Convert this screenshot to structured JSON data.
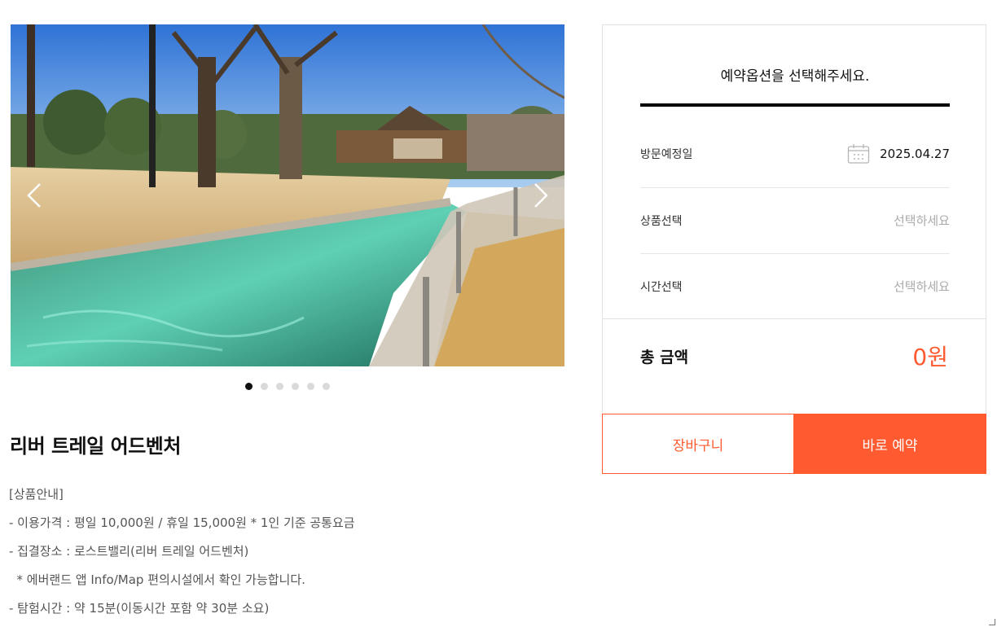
{
  "gallery": {
    "prev_icon": "chevron-left-icon",
    "next_icon": "chevron-right-icon",
    "slide_count": 6,
    "active_slide": 1
  },
  "product": {
    "title": "리버 트레일 어드벤처",
    "info_lines": [
      "[상품안내]",
      "- 이용가격 : 평일 10,000원 / 휴일 15,000원 * 1인 기준 공통요금",
      "- 집결장소 : 로스트밸리(리버 트레일 어드벤처)",
      "  * 에버랜드 앱 Info/Map 편의시설에서 확인 가능합니다.",
      "- 탐험시간 : 약 15분(이동시간 포함 약 30분 소요)"
    ]
  },
  "booking": {
    "heading": "예약옵션을 선택해주세요.",
    "visit_date_label": "방문예정일",
    "visit_date_value": "2025.04.27",
    "calendar_icon": "calendar-icon",
    "product_label": "상품선택",
    "product_placeholder": "선택하세요",
    "time_label": "시간선택",
    "time_placeholder": "선택하세요",
    "total_label": "총 금액",
    "total_value": "0원",
    "cart_button": "장바구니",
    "book_button": "바로 예약"
  },
  "colors": {
    "accent": "#ff5a30",
    "text": "#111111",
    "muted": "#aaaaaa",
    "border": "#e2e2e2"
  }
}
